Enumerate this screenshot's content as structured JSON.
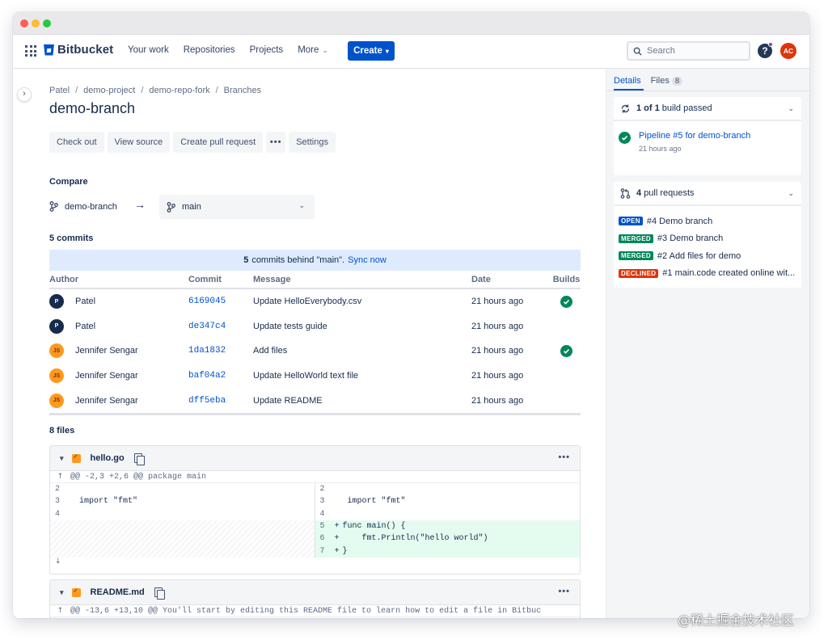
{
  "nav": {
    "brand": "Bitbucket",
    "links": [
      "Your work",
      "Repositories",
      "Projects",
      "More"
    ],
    "create_label": "Create",
    "search_placeholder": "Search",
    "help_label": "?",
    "avatar_initials": "AC"
  },
  "breadcrumb": [
    "Patel",
    "demo-project",
    "demo-repo-fork",
    "Branches"
  ],
  "page_title": "demo-branch",
  "actions": [
    "Check out",
    "View source",
    "Create pull request",
    "•••",
    "Settings"
  ],
  "compare": {
    "label": "Compare",
    "source": "demo-branch",
    "destination": "main"
  },
  "commits": {
    "label": "5 commits",
    "banner_count": "5",
    "banner_text": "commits behind \"main\".",
    "banner_link": "Sync now",
    "headers": [
      "Author",
      "Commit",
      "Message",
      "Date",
      "Builds"
    ],
    "rows": [
      {
        "initials": "P",
        "author": "Patel",
        "hash": "6169045",
        "message": "Update HelloEverybody.csv",
        "date": "21 hours ago",
        "build": true
      },
      {
        "initials": "P",
        "author": "Patel",
        "hash": "de347c4",
        "message": "Update tests guide",
        "date": "21 hours ago",
        "build": false
      },
      {
        "initials": "JS",
        "author": "Jennifer Sengar",
        "hash": "1da1832",
        "message": "Add files",
        "date": "21 hours ago",
        "build": true
      },
      {
        "initials": "JS",
        "author": "Jennifer Sengar",
        "hash": "baf04a2",
        "message": "Update HelloWorld text file",
        "date": "21 hours ago",
        "build": false
      },
      {
        "initials": "JS",
        "author": "Jennifer Sengar",
        "hash": "dff5eba",
        "message": "Update README",
        "date": "21 hours ago",
        "build": false
      }
    ]
  },
  "files": {
    "label": "8 files",
    "diffs": [
      {
        "name": "hello.go",
        "hunk": "@@ -2,3 +2,6 @@ package main",
        "left_lines": [
          {
            "n": "2",
            "code": ""
          },
          {
            "n": "3",
            "code": "import \"fmt\""
          },
          {
            "n": "4",
            "code": ""
          }
        ],
        "right_lines": [
          {
            "n": "2",
            "code": "",
            "mark": ""
          },
          {
            "n": "3",
            "code": "import \"fmt\"",
            "mark": ""
          },
          {
            "n": "4",
            "code": "",
            "mark": ""
          },
          {
            "n": "5",
            "code": "func main() {",
            "mark": "+"
          },
          {
            "n": "6",
            "code": "    fmt.Println(\"hello world\")",
            "mark": "+"
          },
          {
            "n": "7",
            "code": "}",
            "mark": "+"
          }
        ]
      },
      {
        "name": "README.md",
        "hunk": "@@ -13,6 +13,10 @@ You'll start by editing this README file to learn how to edit a file in Bitbuc"
      }
    ]
  },
  "sidebar": {
    "tabs": [
      {
        "label": "Details"
      },
      {
        "label": "Files",
        "count": "8"
      }
    ],
    "builds": {
      "count_text": "1 of 1",
      "suffix": "build passed"
    },
    "pipeline": {
      "title": "Pipeline #5 for demo-branch",
      "time": "21 hours ago"
    },
    "pull_requests": {
      "count": "4",
      "suffix": "pull requests",
      "items": [
        {
          "status": "OPEN",
          "title": "#4 Demo branch"
        },
        {
          "status": "MERGED",
          "title": "#3 Demo branch"
        },
        {
          "status": "MERGED",
          "title": "#2 Add files for demo"
        },
        {
          "status": "DECLINED",
          "title": "#1 main.code created online wit..."
        }
      ]
    }
  },
  "watermark": "@稀土掘金技术社区",
  "colors": {
    "accent": "#0052cc",
    "success": "#00875a",
    "danger": "#de350b",
    "added_line": "#e3fcef",
    "banner": "#deebff"
  }
}
